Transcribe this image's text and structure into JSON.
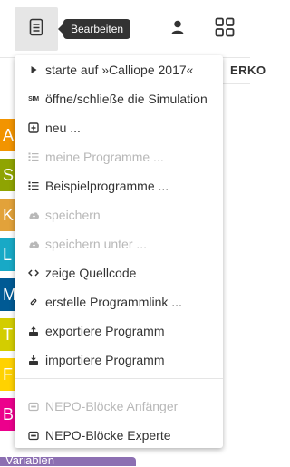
{
  "toolbar": {
    "tooltip": "Bearbeiten"
  },
  "workspace": {
    "tab_label": "ERKO",
    "categories": [
      "A",
      "S",
      "K",
      "L",
      "M",
      "T",
      "F",
      "B"
    ],
    "bottom_label": "Variablen"
  },
  "menu": {
    "items": [
      {
        "label": "starte auf »Calliope 2017«",
        "icon": "play-icon",
        "disabled": false
      },
      {
        "label": "öffne/schließe die Simulation",
        "icon": "sim-icon",
        "icon_text": "SIM",
        "disabled": false
      },
      {
        "label": "neu ...",
        "icon": "plus-square-icon",
        "disabled": false
      },
      {
        "label": "meine Programme ...",
        "icon": "list-icon",
        "disabled": true
      },
      {
        "label": "Beispielprogramme ...",
        "icon": "list-icon",
        "disabled": false
      },
      {
        "label": "speichern",
        "icon": "cloud-upload-icon",
        "disabled": true
      },
      {
        "label": "speichern unter ...",
        "icon": "cloud-upload-icon",
        "disabled": true
      },
      {
        "label": "zeige Quellcode",
        "icon": "code-icon",
        "disabled": false
      },
      {
        "label": "erstelle Programmlink ...",
        "icon": "link-icon",
        "disabled": false
      },
      {
        "label": "exportiere Programm",
        "icon": "export-icon",
        "disabled": false
      },
      {
        "label": "importiere Programm",
        "icon": "import-icon",
        "disabled": false
      },
      {
        "label": "NEPO-Blöcke Anfänger",
        "icon": "blocks-icon",
        "disabled": true
      },
      {
        "label": "NEPO-Blöcke Experte",
        "icon": "blocks-icon",
        "disabled": false
      }
    ]
  },
  "colors": {
    "text": "#333333",
    "disabled": "#b8b8b8",
    "tooltip_bg": "#333333",
    "active_button_bg": "#e6e6e6",
    "category_colors": [
      "#f29400",
      "#8fa402",
      "#e2a23a",
      "#18a9c6",
      "#005a94",
      "#d3cd00",
      "#ffd200",
      "#ec008c"
    ],
    "variables": "#8c6fb2"
  }
}
